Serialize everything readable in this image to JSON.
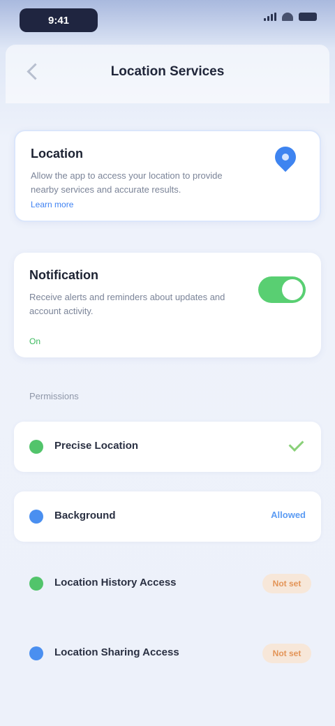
{
  "status_bar": {
    "time": "9:41"
  },
  "nav": {
    "title": "Location Services"
  },
  "location_card": {
    "title": "Location",
    "description": "Allow the app to access your location to provide nearby services and accurate results.",
    "link": "Learn more",
    "icon": "location-pin-icon"
  },
  "notify_card": {
    "title": "Notification",
    "description": "Receive alerts and reminders about updates and account activity.",
    "link": "On",
    "toggle_on": true
  },
  "permissions": {
    "section_label": "Permissions",
    "items": [
      {
        "label": "Precise Location",
        "status": "On",
        "icon": "green-dot-icon"
      },
      {
        "label": "Background",
        "status": "Allowed",
        "icon": "blue-dot-icon"
      },
      {
        "label": "Location History Access",
        "status": "Not set",
        "icon": "green-dot-icon"
      },
      {
        "label": "Location Sharing Access",
        "status": "Not set",
        "icon": "blue-dot-icon"
      }
    ]
  },
  "colors": {
    "accent_blue": "#3e84f0",
    "toggle_green": "#59cf72",
    "pending_orange": "#e39457"
  }
}
